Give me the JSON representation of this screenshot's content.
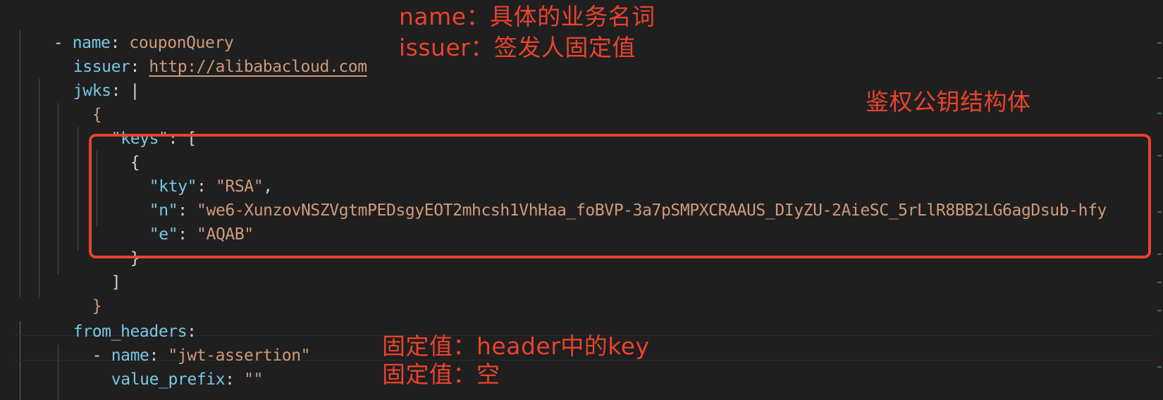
{
  "editor": {
    "lines": {
      "l1_dash": "- ",
      "l1_key": "name",
      "l1_colon": ": ",
      "l1_val": "couponQuery",
      "l2_key": "issuer",
      "l2_colon": ": ",
      "l2_val": "http://alibabacloud.com",
      "l3_key": "jwks",
      "l3_rest": ": |",
      "l4": "{",
      "l5_key": "\"keys\"",
      "l5_rest": ": [",
      "l6": "{",
      "l7_key": "\"kty\"",
      "l7_colon": ": ",
      "l7_val": "\"RSA\"",
      "l7_comma": ",",
      "l8_key": "\"n\"",
      "l8_colon": ": ",
      "l8_val": "\"we6-XunzovNSZVgtmPEDsgyEOT2mhcsh1VhHaa_foBVP-3a7pSMPXCRAAUS_DIyZU-2AieSC_5rLlR8BB2LG6agDsub-hfy",
      "l9_key": "\"e\"",
      "l9_colon": ": ",
      "l9_val": "\"AQAB\"",
      "l10": "}",
      "l11": "]",
      "l12": "}",
      "l13_key": "from_headers",
      "l13_colon": ":",
      "l14_dash": "- ",
      "l14_key": "name",
      "l14_colon": ": ",
      "l14_val": "\"jwt-assertion\"",
      "l15_key": "value_prefix",
      "l15_colon": ": ",
      "l15_val": "\"\""
    }
  },
  "annotations": {
    "name_note": "name：具体的业务名词",
    "issuer_note": "issuer：签发人固定值",
    "keys_note": "鉴权公钥结构体",
    "header_note": "固定值：header中的key",
    "prefix_note": "固定值：空"
  },
  "colors": {
    "background": "#1f1f1f",
    "key": "#79c7e4",
    "string": "#d19a7a",
    "annotation": "#e8432d"
  }
}
